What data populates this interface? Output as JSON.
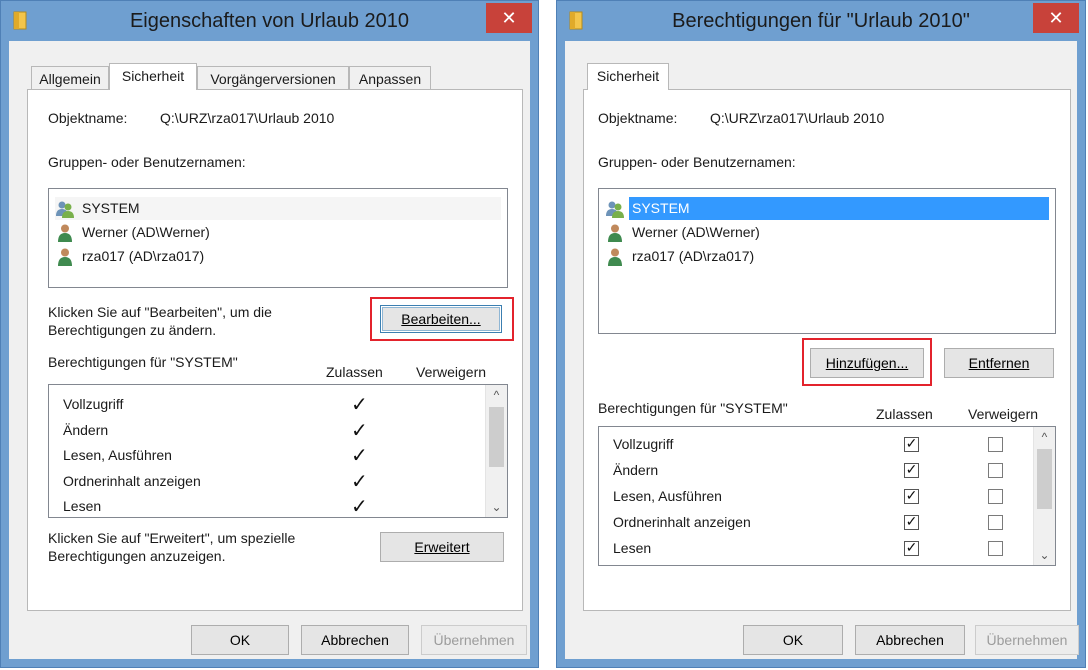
{
  "left": {
    "title": "Eigenschaften von Urlaub 2010",
    "tabs": [
      "Allgemein",
      "Sicherheit",
      "Vorgängerversionen",
      "Anpassen"
    ],
    "active_tab": "Sicherheit",
    "object_label": "Objektname:",
    "object_value": "Q:\\URZ\\rza017\\Urlaub 2010",
    "groups_label": "Gruppen- oder Benutzernamen:",
    "users": [
      "SYSTEM",
      "Werner (AD\\Werner)",
      "rza017 (AD\\rza017)"
    ],
    "edit_hint_line1": "Klicken Sie auf \"Bearbeiten\", um die",
    "edit_hint_line2": "Berechtigungen zu ändern.",
    "edit_button": "Bearbeiten...",
    "perm_header": "Berechtigungen für \"SYSTEM\"",
    "col_allow": "Zulassen",
    "col_deny": "Verweigern",
    "permissions": [
      "Vollzugriff",
      "Ändern",
      "Lesen, Ausführen",
      "Ordnerinhalt anzeigen",
      "Lesen"
    ],
    "adv_hint_line1": "Klicken Sie auf \"Erweitert\", um spezielle",
    "adv_hint_line2": "Berechtigungen anzuzeigen.",
    "advanced_button": "Erweitert",
    "ok": "OK",
    "cancel": "Abbrechen",
    "apply": "Übernehmen"
  },
  "right": {
    "title": "Berechtigungen für \"Urlaub 2010\"",
    "tabs": [
      "Sicherheit"
    ],
    "object_label": "Objektname:",
    "object_value": "Q:\\URZ\\rza017\\Urlaub 2010",
    "groups_label": "Gruppen- oder Benutzernamen:",
    "users": [
      "SYSTEM",
      "Werner (AD\\Werner)",
      "rza017 (AD\\rza017)"
    ],
    "selected_user": "SYSTEM",
    "add_button": "Hinzufügen...",
    "remove_button": "Entfernen",
    "perm_header": "Berechtigungen für \"SYSTEM\"",
    "col_allow": "Zulassen",
    "col_deny": "Verweigern",
    "permissions": [
      "Vollzugriff",
      "Ändern",
      "Lesen, Ausführen",
      "Ordnerinhalt anzeigen",
      "Lesen"
    ],
    "ok": "OK",
    "cancel": "Abbrechen",
    "apply": "Übernehmen"
  },
  "glyphs": {
    "close": "✕",
    "check": "✓",
    "up_arrow": "^",
    "down_arrow": "⌄"
  },
  "colors": {
    "titlebar": "#6f9fd0",
    "close_button": "#c8423a",
    "highlight_box": "#e3232c",
    "selection": "#3399ff"
  }
}
